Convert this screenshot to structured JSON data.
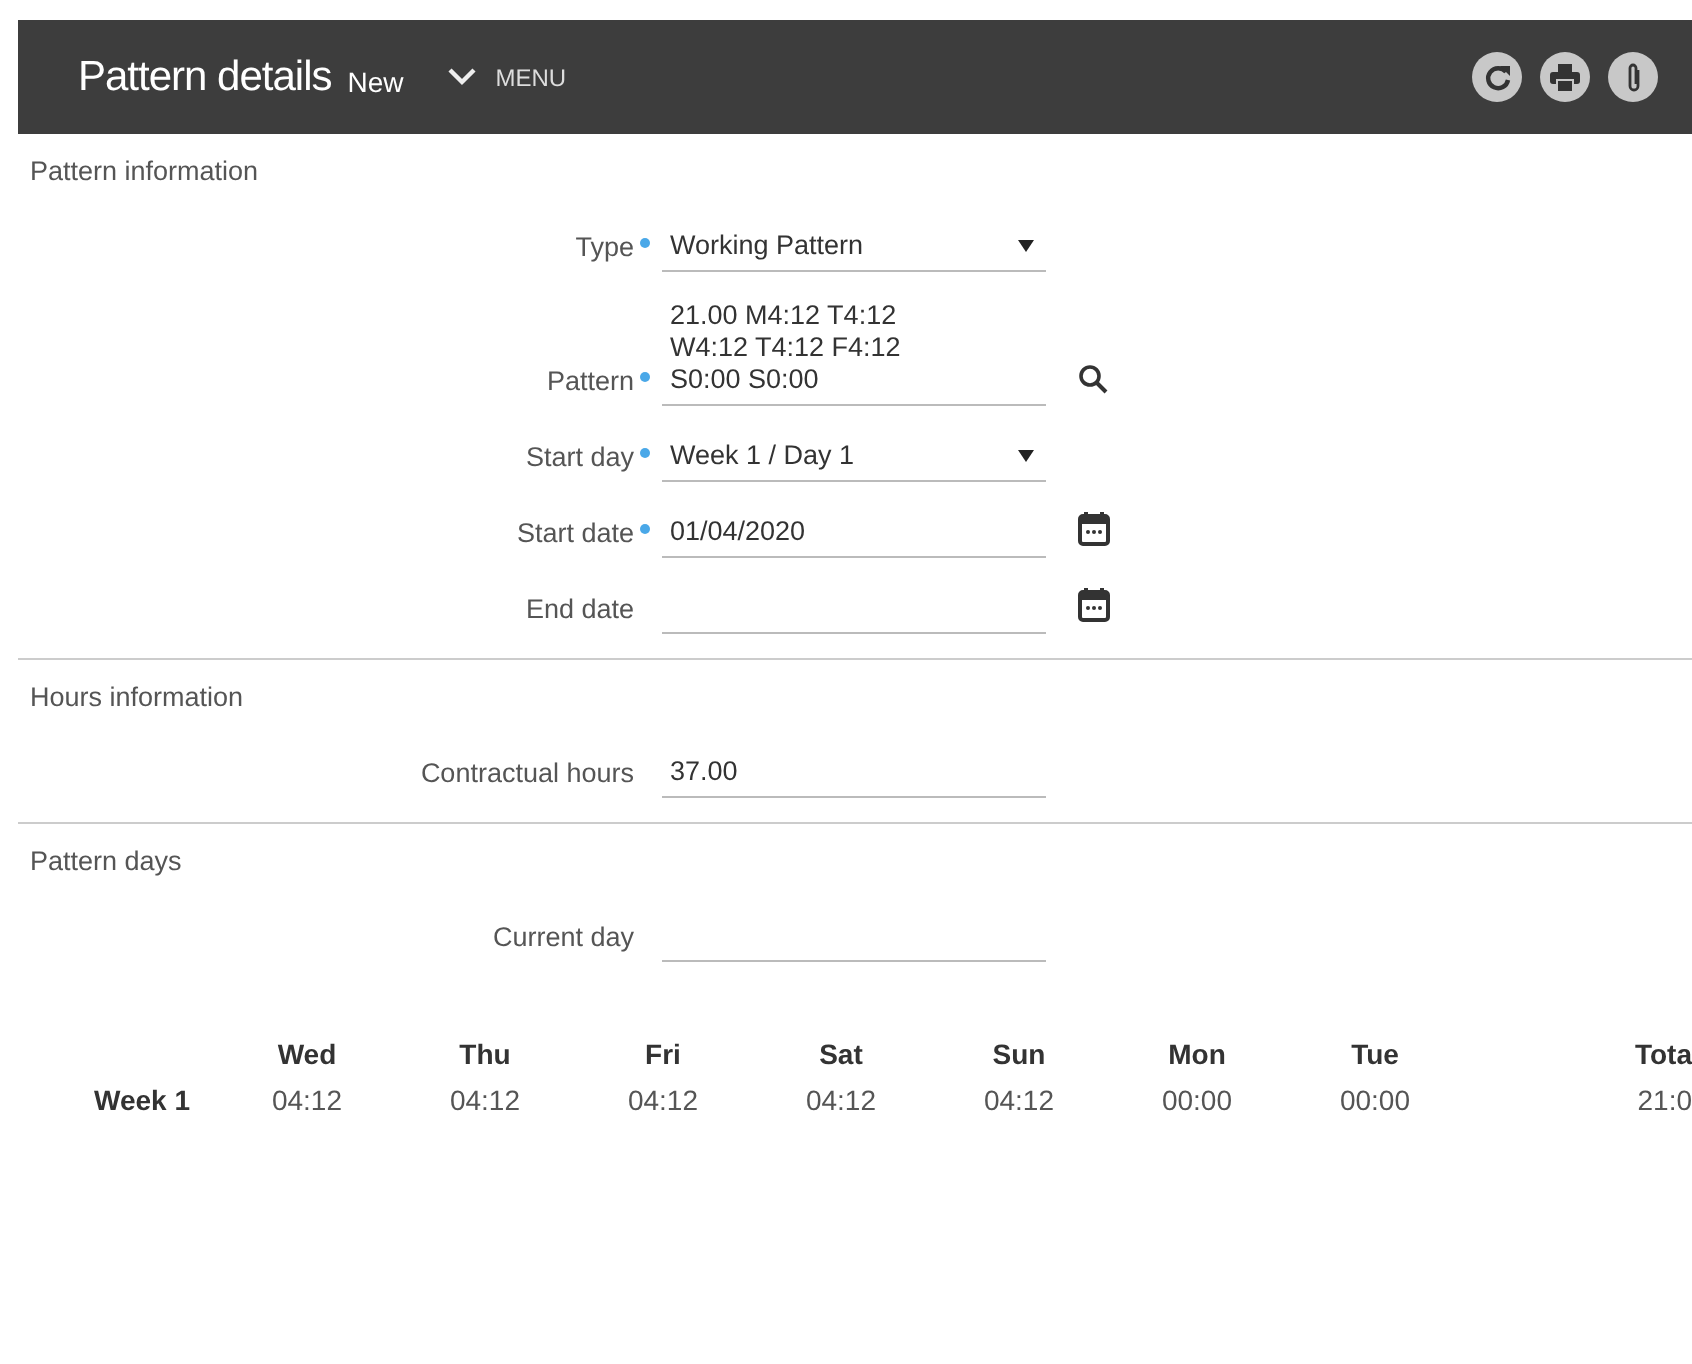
{
  "header": {
    "title": "Pattern details",
    "badge": "New",
    "menu": "MENU"
  },
  "sections": [
    {
      "title": "Pattern information",
      "fields": [
        {
          "label": "Type",
          "required": true,
          "kind": "select",
          "value": "Working Pattern"
        },
        {
          "label": "Pattern",
          "required": true,
          "kind": "search",
          "value": "21.00 M4:12 T4:12 W4:12 T4:12 F4:12 S0:00 S0:00"
        },
        {
          "label": "Start day",
          "required": true,
          "kind": "select",
          "value": "Week 1 / Day 1"
        },
        {
          "label": "Start date",
          "required": true,
          "kind": "date",
          "value": "01/04/2020"
        },
        {
          "label": "End date",
          "required": false,
          "kind": "date"
        }
      ]
    },
    {
      "title": "Hours information",
      "fields": [
        {
          "label": "Contractual hours",
          "required": false,
          "kind": "text",
          "value": "37.00"
        }
      ]
    },
    {
      "title": "Pattern days",
      "fields": [
        {
          "label": "Current day",
          "required": false,
          "kind": "text"
        }
      ]
    }
  ],
  "table": {
    "columns": [
      "Wed",
      "Thu",
      "Fri",
      "Sat",
      "Sun",
      "Mon",
      "Tue",
      "Tota"
    ],
    "rows": [
      {
        "label": "Week 1",
        "cells": [
          "04:12",
          "04:12",
          "04:12",
          "04:12",
          "04:12",
          "00:00",
          "00:00",
          "21:0"
        ]
      }
    ]
  }
}
